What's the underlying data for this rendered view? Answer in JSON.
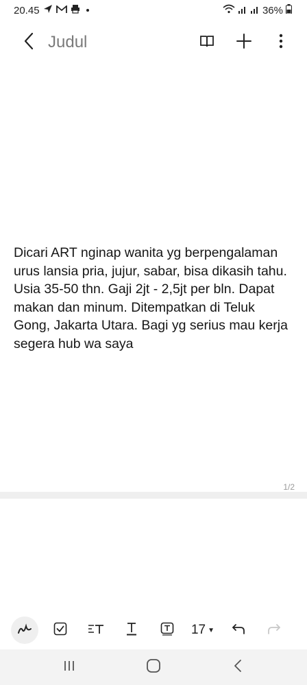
{
  "status_bar": {
    "time": "20.45",
    "battery": "36%",
    "icons": [
      "navigation-arrow-icon",
      "gmail-icon",
      "printer-icon",
      "dot-icon",
      "wifi-icon",
      "signal-icon",
      "signal-icon",
      "battery-icon"
    ]
  },
  "header": {
    "title": "Judul",
    "icons": [
      "back-icon",
      "reading-mode-icon",
      "add-icon",
      "more-icon"
    ]
  },
  "note": {
    "body": "Dicari ART nginap wanita yg berpengalaman urus lansia pria, jujur, sabar, bisa dikasih tahu. Usia 35-50 thn. Gaji 2jt - 2,5jt per bln. Dapat makan dan minum. Ditempatkan di Teluk Gong, Jakarta Utara. Bagi yg serius mau kerja segera hub wa saya",
    "page_indicator": "1/2"
  },
  "toolbar": {
    "font_size": "17",
    "icons": [
      "pen-icon",
      "checkbox-icon",
      "text-style-icon",
      "text-underline-icon",
      "text-box-icon",
      "font-size-dropdown-icon",
      "undo-icon",
      "redo-icon"
    ]
  },
  "nav_bar": {
    "icons": [
      "recent-apps-icon",
      "home-icon",
      "back-icon"
    ]
  },
  "colors": {
    "background": "#ffffff",
    "title_gray": "#7a7a7a",
    "divider": "#efefef",
    "nav_bg": "#f3f3f3",
    "disabled": "#c8c8c8"
  }
}
